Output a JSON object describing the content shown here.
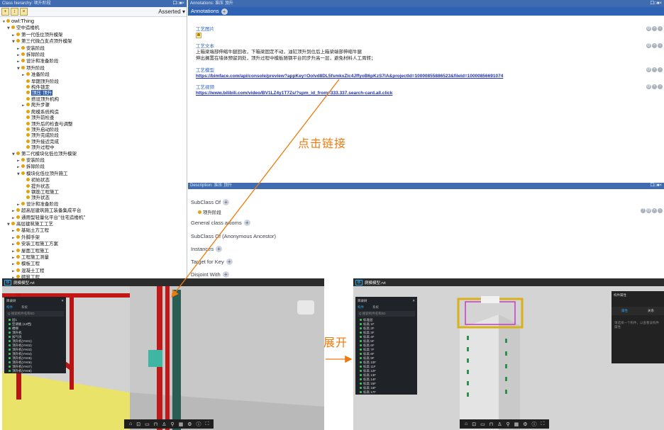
{
  "hierarchy": {
    "header": "Class hierarchy: 项升阶段",
    "controls": "口□■×",
    "toolbar": {
      "mode": "Asserted ▾"
    },
    "nodes": [
      {
        "text": "owl:Thing",
        "depth": 0,
        "toggle": "▼",
        "root": true
      },
      {
        "text": "空中造楼机",
        "depth": 1,
        "toggle": "▼"
      },
      {
        "text": "第一代低位顶升模架",
        "depth": 2,
        "toggle": "►"
      },
      {
        "text": "第三代微凸支点顶升模架",
        "depth": 2,
        "toggle": "▼"
      },
      {
        "text": "安装阶段",
        "depth": 3,
        "toggle": "►"
      },
      {
        "text": "拆除阶段",
        "depth": 3,
        "toggle": "►"
      },
      {
        "text": "设计和准备阶段",
        "depth": 3,
        "toggle": "►"
      },
      {
        "text": "项升阶段",
        "depth": 3,
        "toggle": "▼"
      },
      {
        "text": "准备阶段",
        "depth": 4,
        "toggle": "►"
      },
      {
        "text": "早期顶升阶段",
        "depth": 4,
        "toggle": ""
      },
      {
        "text": "构件锁定",
        "depth": 4,
        "toggle": ""
      },
      {
        "text": "顶压 顶升",
        "depth": 4,
        "toggle": "",
        "selected": true
      },
      {
        "text": "搭设顶升机构",
        "depth": 4,
        "toggle": ""
      },
      {
        "text": "爬升步骤",
        "depth": 4,
        "toggle": "►"
      },
      {
        "text": "爬模系统构造",
        "depth": 4,
        "toggle": ""
      },
      {
        "text": "顶升前检查",
        "depth": 4,
        "toggle": ""
      },
      {
        "text": "顶升后的检查与调整",
        "depth": 4,
        "toggle": ""
      },
      {
        "text": "顶升启动阶段",
        "depth": 4,
        "toggle": ""
      },
      {
        "text": "顶升完成阶段",
        "depth": 4,
        "toggle": ""
      },
      {
        "text": "顶升接近完成",
        "depth": 4,
        "toggle": ""
      },
      {
        "text": "顶升过程中",
        "depth": 4,
        "toggle": ""
      },
      {
        "text": "第二代模块化低位顶升模架",
        "depth": 2,
        "toggle": "▼"
      },
      {
        "text": "安装阶段",
        "depth": 3,
        "toggle": "►"
      },
      {
        "text": "拆除阶段",
        "depth": 3,
        "toggle": "►"
      },
      {
        "text": "模块化低位顶升施工",
        "depth": 3,
        "toggle": "▼"
      },
      {
        "text": "初始状态",
        "depth": 4,
        "toggle": ""
      },
      {
        "text": "提升状态",
        "depth": 4,
        "toggle": ""
      },
      {
        "text": "钢筋工程施工",
        "depth": 4,
        "toggle": ""
      },
      {
        "text": "顶升状态",
        "depth": 4,
        "toggle": ""
      },
      {
        "text": "设计和准备阶段",
        "depth": 3,
        "toggle": "►"
      },
      {
        "text": "超高层建筑施工装备集成平台",
        "depth": 2,
        "toggle": "►"
      },
      {
        "text": "通用型轻量化平台\"住宅造楼机\"",
        "depth": 2,
        "toggle": "►"
      },
      {
        "text": "高层建筑施工工艺",
        "depth": 1,
        "toggle": "▼"
      },
      {
        "text": "基础土方工程",
        "depth": 2,
        "toggle": "►"
      },
      {
        "text": "外脚手架",
        "depth": 2,
        "toggle": "►"
      },
      {
        "text": "安装工程施工方案",
        "depth": 2,
        "toggle": "►"
      },
      {
        "text": "屋面工程施工",
        "depth": 2,
        "toggle": "►"
      },
      {
        "text": "工程施工测量",
        "depth": 2,
        "toggle": "►"
      },
      {
        "text": "模板工程",
        "depth": 2,
        "toggle": "►"
      },
      {
        "text": "混凝土工程",
        "depth": 2,
        "toggle": "►"
      },
      {
        "text": "砌筑工程",
        "depth": 2,
        "toggle": "►"
      }
    ]
  },
  "annotations": {
    "header": "Annotations: 准压 顶升",
    "bar_label": "Annotations",
    "items": [
      {
        "label": "工艺图片",
        "kind": "image",
        "value": "iconfont"
      },
      {
        "label": "工艺文本",
        "kind": "text",
        "value": "上箱梁端部伸缩牛腿回收，下箱梁固定不动，油缸顶升到位后上箱梁端部伸缩牛腿\n伸出搁置在墙体预留洞处，顶升过程中模板随钢平台同步升高一层，避免材料人工周转；"
      },
      {
        "label": "工艺模型",
        "kind": "link",
        "value": "https://bimface.com/api/console/preview?appKey=Oolvd8DL5fsmkxZlc4JffyoB6pKzS7lA&projectId=10000855886523&fileId=10000856691074"
      },
      {
        "label": "工艺视频",
        "kind": "link",
        "value": "https://www.bilibili.com/video/BV1LZ4y1T7Zs/?spm_id_from=333.337.search-card.all.click"
      }
    ]
  },
  "description": {
    "header": "Description: 准压 顶升",
    "sections": {
      "subclass_of": "SubClass Of",
      "subclass_value": "项升阶段",
      "general_axioms": "General class axioms",
      "anon_ancestor": "SubClass Of (Anonymous Ancestor)",
      "instances": "Instances",
      "target_for_key": "Target for Key",
      "disjoint_with": "Disjoint With"
    }
  },
  "callouts": {
    "click_link": "点击链接",
    "expand": "展开"
  },
  "viewer_left": {
    "title": "爬模模型.rvt",
    "panel_title": "目录树",
    "tabs": [
      "构件",
      "系统"
    ],
    "search": "Q  搜索构件名称/ID",
    "items": [
      "层1",
      "空调板 (12档)",
      "楼梯",
      "顶升机",
      "加气块",
      "顶升机(YH01)",
      "顶升机(YH02)",
      "顶升机(YH03)",
      "顶升机(YH04)",
      "顶升机(YH05)",
      "顶升机(YH06)",
      "顶升机(YH07)",
      "顶升机(YH08)"
    ]
  },
  "viewer_right": {
    "title": "爬模模型.rvt",
    "panel_title": "目录树",
    "tabs": [
      "构件",
      "系统"
    ],
    "search": "Q  搜索构件名称/ID",
    "items": [
      "标准层",
      "标高 1F",
      "标高 2F",
      "标高 3F",
      "标高 4F",
      "标高 5F",
      "标高 6F",
      "标高 7F",
      "标高 8F",
      "标高 9F",
      "标高 10F",
      "标高 11F",
      "标高 12F",
      "标高 13F",
      "标高 14F",
      "标高 15F",
      "标高 16F",
      "标高 17F"
    ],
    "props_title": "构件属性",
    "props_tabs": [
      "属性",
      "关系"
    ],
    "props_hint": "请选择一个构件，以查看该构件属性"
  },
  "toolbar_icons": [
    "home-icon",
    "zoom-icon",
    "measure-icon",
    "section-icon",
    "walk-icon",
    "pin-icon",
    "model-tree-icon",
    "settings-icon",
    "info-icon",
    "fullscreen-icon"
  ],
  "colors": {
    "accent": "#2d62b5",
    "callout": "#ee7a0b",
    "selection": "#2d5dab"
  }
}
